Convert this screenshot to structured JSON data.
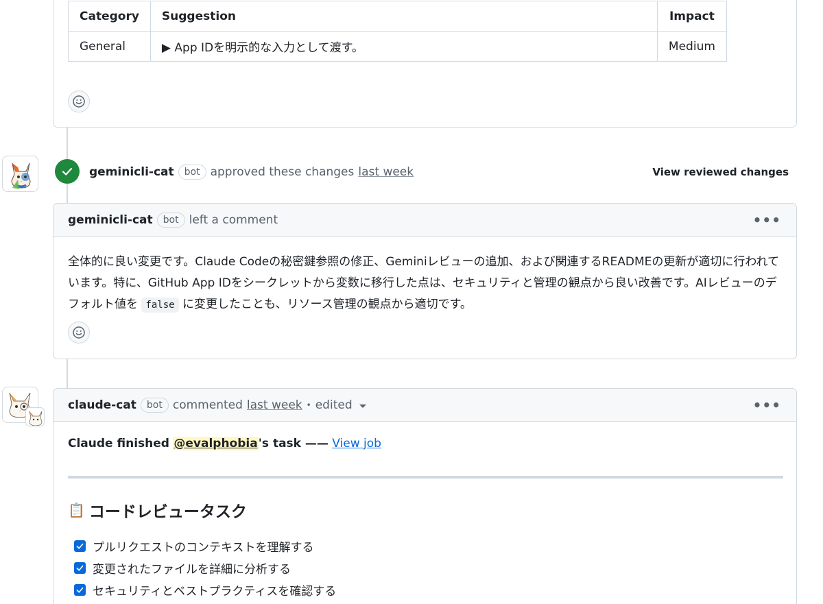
{
  "top_card": {
    "table": {
      "headers": [
        "Category",
        "Suggestion",
        "Impact"
      ],
      "rows": [
        {
          "category": "General",
          "suggestion": "▶ App IDを明示的な入力として渡す。",
          "impact": "Medium"
        }
      ]
    }
  },
  "review": {
    "author": "geminicli-cat",
    "bot_label": "bot",
    "action": "approved these changes",
    "time": "last week",
    "view_reviewed": "View reviewed changes"
  },
  "review_comment": {
    "author": "geminicli-cat",
    "bot_label": "bot",
    "action": "left a comment",
    "menu": "•••",
    "body_part1": "全体的に良い変更です。Claude Codeの秘密鍵参照の修正、Geminiレビューの追加、および関連するREADMEの更新が適切に行われています。特に、GitHub App IDをシークレットから変数に移行した点は、セキュリティと管理の観点から良い改善です。AIレビューのデフォルト値を",
    "body_code": "false",
    "body_part2": "に変更したことも、リソース管理の観点から適切です。"
  },
  "claude_comment": {
    "author": "claude-cat",
    "bot_label": "bot",
    "action": "commented",
    "time": "last week",
    "separator": "•",
    "edited": "edited",
    "menu": "•••",
    "status_prefix": "Claude finished",
    "mention": "@evalphobia",
    "status_suffix": "'s task ——",
    "view_job": "View job",
    "task_title": "コードレビュータスク",
    "task_icon": "📋",
    "tasks": [
      {
        "label": "プルリクエストのコンテキストを理解する",
        "checked": true
      },
      {
        "label": "変更されたファイルを詳細に分析する",
        "checked": true
      },
      {
        "label": "セキュリティとベストプラクティスを確認する",
        "checked": true
      }
    ]
  }
}
